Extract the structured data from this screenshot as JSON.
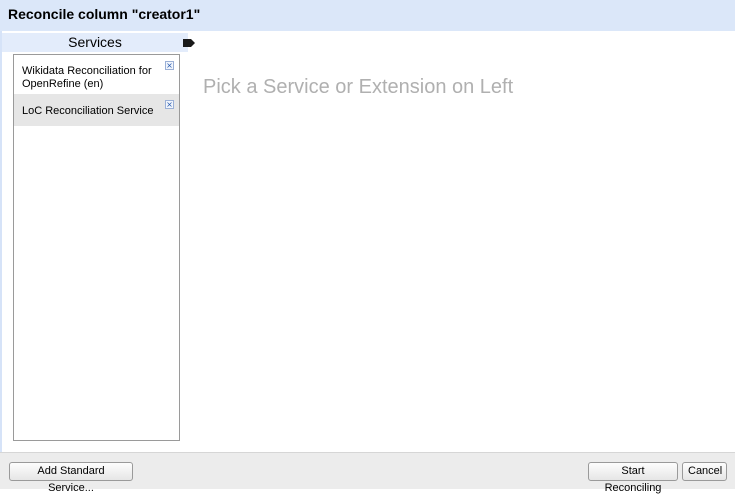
{
  "dialog": {
    "title": "Reconcile column \"creator1\""
  },
  "services_panel": {
    "header": "Services",
    "items": [
      {
        "label": "Wikidata Reconciliation for OpenRefine (en)",
        "remove_symbol": "×"
      },
      {
        "label": "LoC Reconciliation Service",
        "remove_symbol": "×"
      }
    ]
  },
  "main": {
    "placeholder": "Pick a Service or Extension on Left"
  },
  "footer": {
    "add_service_label": "Add Standard Service...",
    "start_label": "Start Reconciling",
    "cancel_label": "Cancel"
  },
  "colors": {
    "header_bg": "#dbe7f9",
    "selected_item_bg": "#e6e6e6",
    "placeholder_text": "#b0b0b0",
    "footer_bg": "#ececec"
  },
  "icons": {
    "panel_arrow": "tag-arrow-icon",
    "remove": "close-icon"
  }
}
